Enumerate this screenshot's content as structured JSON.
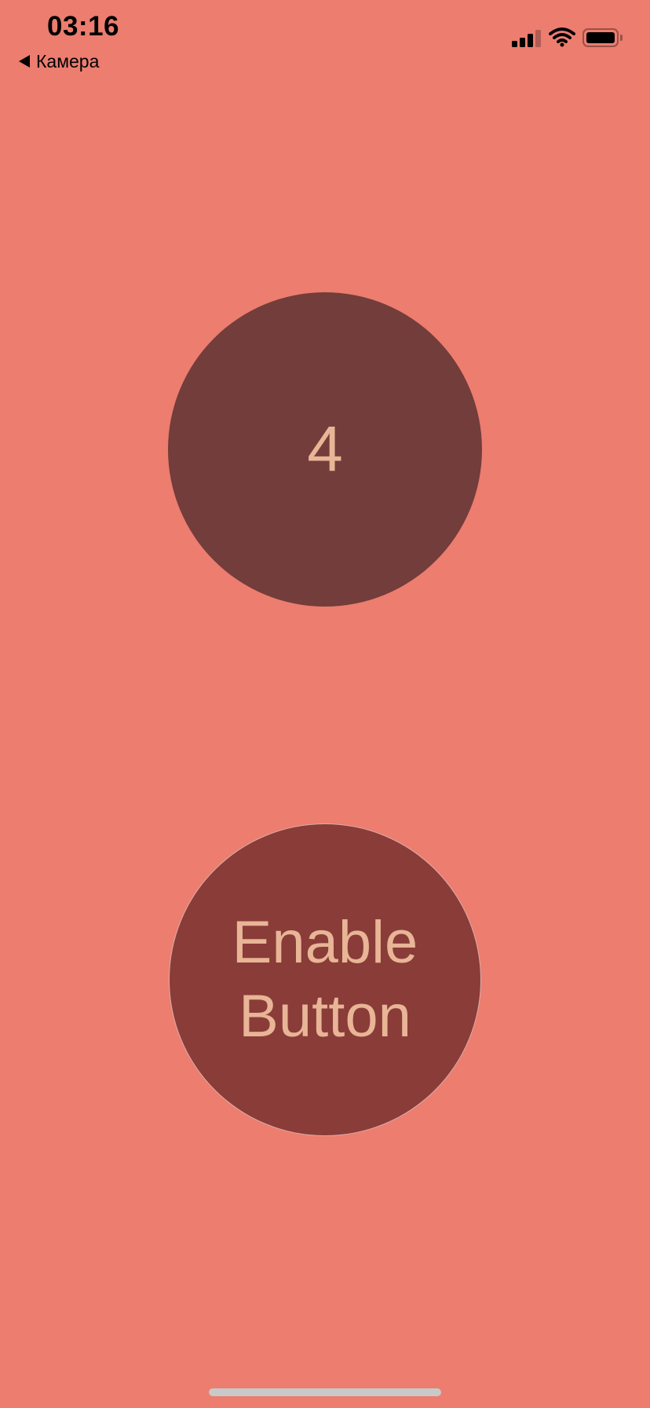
{
  "status_bar": {
    "time": "03:16",
    "back_label": "Камера",
    "signal_icon": "cellular-signal-icon",
    "wifi_icon": "wifi-icon",
    "battery_icon": "battery-icon"
  },
  "main": {
    "counter_value": "4",
    "enable_button_label": "Enable Button"
  },
  "colors": {
    "background": "#ec7d6f",
    "counter_circle": "#723d3b",
    "button_circle": "#8a3c39",
    "text": "#e8b596"
  }
}
